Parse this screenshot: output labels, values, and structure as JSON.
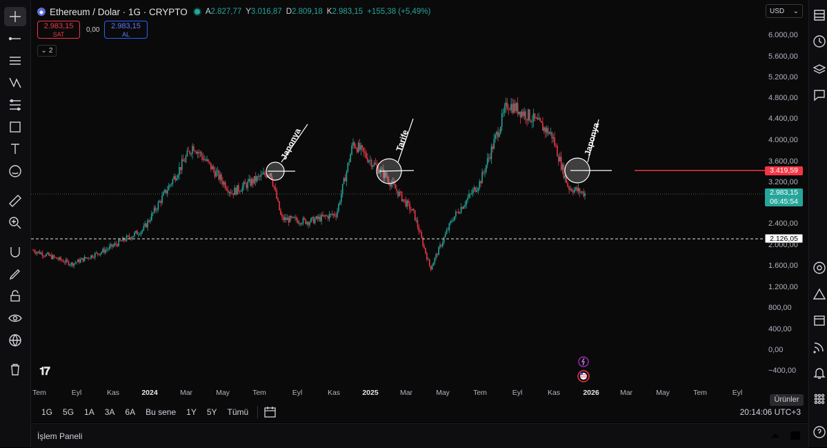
{
  "header": {
    "symbol_title": "Ethereum / Dolar · 1G · CRYPTO",
    "ohlc": {
      "open_label": "A",
      "open": "2.827,77",
      "high_label": "Y",
      "high": "3.016,87",
      "low_label": "D",
      "low": "2.809,18",
      "close_label": "K",
      "close": "2.983,15",
      "change": "+155,38 (+5,49%)"
    },
    "sell": {
      "price": "2.983,15",
      "label": "SAT"
    },
    "spread": "0,00",
    "buy": {
      "price": "2.983,15",
      "label": "AL"
    },
    "indicator_count": "2",
    "currency": "USD"
  },
  "price_scale": {
    "labels": [
      "6.000,00",
      "5.600,00",
      "5.200,00",
      "4.800,00",
      "4.400,00",
      "4.000,00",
      "3.600,00",
      "3.200,00",
      "2.400,00",
      "2.000,00",
      "1.600,00",
      "1.200,00",
      "800,00",
      "400,00",
      "0,00",
      "−400,00"
    ],
    "alert_tag": "3.419,59",
    "last_price_tag": "2.983,15",
    "countdown": "06:45:54",
    "hline_tag": "2.126,05"
  },
  "time_axis": {
    "labels": [
      {
        "text": "Tem",
        "bold": false
      },
      {
        "text": "Eyl",
        "bold": false
      },
      {
        "text": "Kas",
        "bold": false
      },
      {
        "text": "2024",
        "bold": true
      },
      {
        "text": "Mar",
        "bold": false
      },
      {
        "text": "May",
        "bold": false
      },
      {
        "text": "Tem",
        "bold": false
      },
      {
        "text": "Eyl",
        "bold": false
      },
      {
        "text": "Kas",
        "bold": false
      },
      {
        "text": "2025",
        "bold": true
      },
      {
        "text": "Mar",
        "bold": false
      },
      {
        "text": "May",
        "bold": false
      },
      {
        "text": "Tem",
        "bold": false
      },
      {
        "text": "Eyl",
        "bold": false
      },
      {
        "text": "Kas",
        "bold": false
      },
      {
        "text": "2026",
        "bold": true
      },
      {
        "text": "Mar",
        "bold": false
      },
      {
        "text": "May",
        "bold": false
      },
      {
        "text": "Tem",
        "bold": false
      },
      {
        "text": "Eyl",
        "bold": false
      }
    ]
  },
  "annotations": [
    "Japonya",
    "Tarife",
    "Japonya"
  ],
  "range_bar": {
    "buttons": [
      "1G",
      "5G",
      "1A",
      "3A",
      "6A",
      "Bu sene",
      "1Y",
      "5Y",
      "Tümü"
    ],
    "clock": "20:14:06 UTC+3"
  },
  "tooltip": "Ürünler",
  "bottom_panel": {
    "label": "İşlem Paneli"
  },
  "colors": {
    "up": "#26a69a",
    "down": "#f23645",
    "alert": "#f23645"
  },
  "chart_data": {
    "type": "candlestick",
    "title": "Ethereum / Dolar · 1G · CRYPTO",
    "series": [
      {
        "name": "ETHUSD",
        "x": [
          "2023-07",
          "2023-09",
          "2023-11",
          "2024-01",
          "2024-03",
          "2024-05",
          "2024-07",
          "2024-08",
          "2024-09",
          "2024-11",
          "2024-12",
          "2025-01",
          "2025-02",
          "2025-04",
          "2025-05",
          "2025-07",
          "2025-08",
          "2025-09",
          "2025-10",
          "2025-11",
          "2025-12"
        ],
        "close": [
          1900,
          1640,
          1900,
          2300,
          3900,
          3000,
          3400,
          2500,
          2450,
          2600,
          3950,
          3300,
          2600,
          1550,
          2500,
          3200,
          4700,
          4450,
          4100,
          3100,
          2983
        ]
      }
    ],
    "horizontal_lines": [
      2126.05
    ],
    "alert_line": 3419.59,
    "last_price": 2983.15,
    "ylim": [
      -500,
      6300
    ],
    "grid": false
  }
}
